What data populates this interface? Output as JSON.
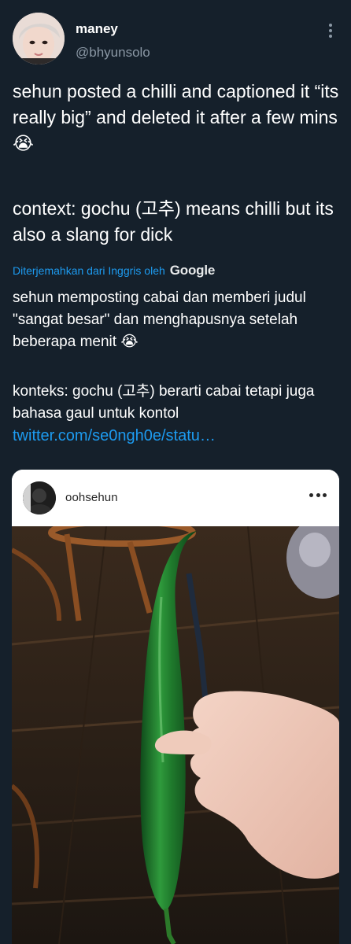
{
  "author": {
    "display_name": "maney",
    "handle": "@bhyunsolo"
  },
  "tweet": {
    "paragraph_1": "sehun posted a chilli and captioned it “its really big” and deleted it after a few mins😭",
    "paragraph_2": "context: gochu (고추) means chilli but its also a slang for dick",
    "translation_label": "Diterjemahkan dari Inggris oleh",
    "translation_provider": "Google",
    "translated_1": "sehun memposting cabai dan memberi judul \"sangat besar\" dan menghapusnya setelah beberapa menit 😭",
    "translated_2": " konteks: gochu (고추) berarti cabai tetapi juga bahasa gaul untuk kontol",
    "link": "twitter.com/se0ngh0e/statu…"
  },
  "embed": {
    "username": "oohsehun"
  },
  "icons": {
    "tweet_menu": "more-vertical-icon",
    "post_menu": "more-horizontal-icon"
  },
  "colors": {
    "background": "#15202b",
    "link": "#1d9bf0",
    "secondary_text": "#8b98a5"
  }
}
